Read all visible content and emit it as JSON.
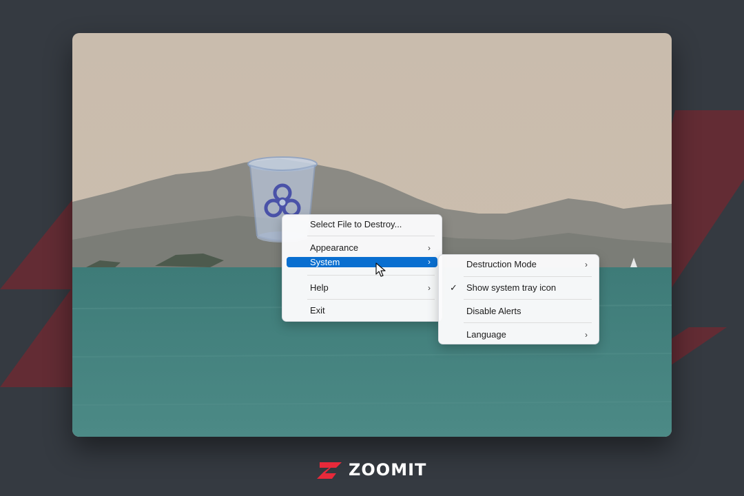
{
  "main_menu": {
    "items": [
      {
        "label": "Select File to Destroy...",
        "has_submenu": false
      },
      {
        "label": "Appearance",
        "has_submenu": true
      },
      {
        "label": "System",
        "has_submenu": true,
        "highlighted": true
      },
      {
        "label": "Help",
        "has_submenu": true
      },
      {
        "label": "Exit",
        "has_submenu": false
      }
    ]
  },
  "system_submenu": {
    "items": [
      {
        "label": "Destruction Mode",
        "has_submenu": true
      },
      {
        "label": "Show system tray icon",
        "checked": true
      },
      {
        "label": "Disable Alerts"
      },
      {
        "label": "Language",
        "has_submenu": true
      }
    ]
  },
  "icons": {
    "app": "biohazard-trash-can-icon",
    "submenu_arrow": "chevron-right-icon",
    "check": "checkmark-icon",
    "cursor": "mouse-pointer-icon"
  },
  "brand": {
    "logo_text": "ZOOMIT",
    "logo_color": "#e8293a"
  },
  "colors": {
    "page_background": "#353a41",
    "stripe": "#6b2a32",
    "menu_highlight": "#0a6fd0",
    "menu_background": "#fbfbfc",
    "water": "#3f7c7a",
    "sky": "#cbbba8"
  }
}
